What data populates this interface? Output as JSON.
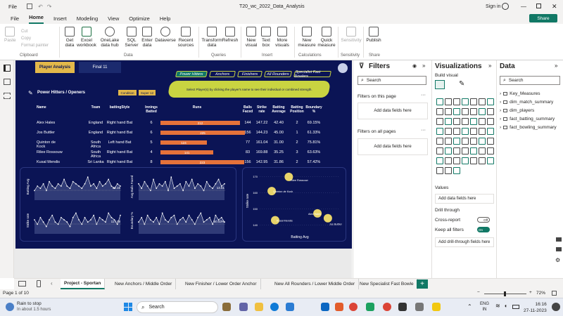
{
  "titlebar": {
    "menu": "File",
    "doc_title": "T20_wc_2022_Data_Analysis",
    "sign_in": "Sign in",
    "share": "Share"
  },
  "menubar": [
    "File",
    "Home",
    "Insert",
    "Modeling",
    "View",
    "Optimize",
    "Help"
  ],
  "ribbon": {
    "clipboard": {
      "paste": "Paste",
      "cut": "Cut",
      "copy": "Copy",
      "format_painter": "Format painter",
      "group": "Clipboard"
    },
    "data": {
      "items": [
        "Get data",
        "Excel workbook",
        "OneLake data hub",
        "SQL Server",
        "Enter data",
        "Dataverse",
        "Recent sources"
      ],
      "group": "Data"
    },
    "queries": {
      "items": [
        "Transform data",
        "Refresh"
      ],
      "group": "Queries"
    },
    "insert": {
      "items": [
        "New visual",
        "Text box",
        "More visuals"
      ],
      "group": "Insert"
    },
    "calculations": {
      "items": [
        "New measure",
        "Quick measure"
      ],
      "group": "Calculations"
    },
    "sensitivity": {
      "items": [
        "Sensitivity"
      ],
      "group": "Sensitivity"
    },
    "share": {
      "items": [
        "Publish"
      ],
      "group": "Share"
    }
  },
  "report": {
    "top_tabs": [
      "Player Analysis",
      "Final 11"
    ],
    "role_tabs": [
      "Power Hitters",
      "Anchors",
      "Finishers",
      "All Rounders",
      "Specialist Fast Bowlers"
    ],
    "instruction": "Select Player(s) by clicking the player's name to see their individual or combined strength.",
    "table_title": "Power Hitters / Openers",
    "filter_buttons": [
      "Condition",
      "Super 12"
    ],
    "columns": [
      "Name",
      "Team",
      "battingStyle",
      "Innings Batted",
      "Runs",
      "Balls Faced",
      "Strike rate",
      "Batting Average",
      "Batting Position",
      "Boundary %"
    ],
    "rows": [
      {
        "name": "Alex Hales",
        "team": "England",
        "style": "Right hand Bat",
        "innings": "6",
        "runs": "212",
        "balls": "144",
        "sr": "147.22",
        "avg": "42.40",
        "pos": "2",
        "bnd": "69.15%"
      },
      {
        "name": "Jos Buttler",
        "team": "England",
        "style": "Right hand Bat",
        "innings": "6",
        "runs": "225",
        "balls": "156",
        "sr": "144.23",
        "avg": "45.00",
        "pos": "1",
        "bnd": "61.33%"
      },
      {
        "name": "Quinton de Kock",
        "team": "South Africa",
        "style": "Left hand Bat",
        "innings": "5",
        "runs": "124",
        "balls": "77",
        "sr": "161.04",
        "avg": "31.00",
        "pos": "2",
        "bnd": "75.81%"
      },
      {
        "name": "Rilee Rossouw",
        "team": "South Africa",
        "style": "Right hand Bat",
        "innings": "4",
        "runs": "141",
        "balls": "83",
        "sr": "169.88",
        "avg": "35.25",
        "pos": "3",
        "bnd": "63.63%"
      },
      {
        "name": "Kusal Mendis",
        "team": "Sri Lanka",
        "style": "Right hand Bat",
        "innings": "8",
        "runs": "223",
        "balls": "156",
        "sr": "142.95",
        "avg": "31.86",
        "pos": "2",
        "bnd": "57.42%"
      }
    ],
    "runs_max": 225,
    "mini_charts": [
      {
        "ylabel": "Batting Avg",
        "value": "20.16"
      },
      {
        "ylabel": "Avg Balls Faced",
        "value": "13.61"
      },
      {
        "ylabel": "Strike rate",
        "value": "117.08"
      },
      {
        "ylabel": "Boundary %",
        "value": "50.53%"
      }
    ]
  },
  "chart_data": {
    "type": "scatter",
    "xlabel": "Batting Avg",
    "ylabel": "Strike rate",
    "y_ticks": [
      "170",
      "160",
      "150",
      "140"
    ],
    "points": [
      {
        "name": "Rilee Rossouw",
        "x": 35.25,
        "y": 169.88
      },
      {
        "name": "Quinton de Kock",
        "x": 31.0,
        "y": 161.04
      },
      {
        "name": "Alex Hales",
        "x": 42.4,
        "y": 147.22
      },
      {
        "name": "Jos Buttler",
        "x": 45.0,
        "y": 144.23
      },
      {
        "name": "Kusal Mendis",
        "x": 31.86,
        "y": 142.95
      }
    ],
    "xlim": [
      28,
      48
    ],
    "ylim": [
      138,
      172
    ],
    "color": "#e8d46a"
  },
  "filters": {
    "title": "Filters",
    "search": "Search",
    "on_page": "Filters on this page",
    "on_all": "Filters on all pages",
    "add": "Add data fields here"
  },
  "viz": {
    "title": "Visualizations",
    "build": "Build visual",
    "values": "Values",
    "add": "Add data fields here",
    "drill": "Drill through",
    "cross": "Cross-report",
    "cross_state": "Off",
    "keep": "Keep all filters",
    "keep_state": "On",
    "add_drill": "Add drill-through fields here"
  },
  "data": {
    "title": "Data",
    "search": "Search",
    "tables": [
      "Key_Measures",
      "dim_match_summary",
      "dim_players",
      "fact_batting_summary",
      "fact_bowling_summary"
    ]
  },
  "pages": [
    "Project - Sportan",
    "New Anchors / Middle Order",
    "New Finisher / Lower Order Anchor",
    "New All Rounders / Lower Middle Order",
    "New Specialist Fast Bowle"
  ],
  "status": {
    "page": "Page 1 of 10",
    "zoom": "72%"
  },
  "taskbar": {
    "weather": "Rain to stop",
    "weather_sub": "In about 1.5 hours",
    "search": "Search",
    "lang1": "ENG",
    "lang2": "IN",
    "time": "16:16",
    "date": "27-11-2023"
  }
}
